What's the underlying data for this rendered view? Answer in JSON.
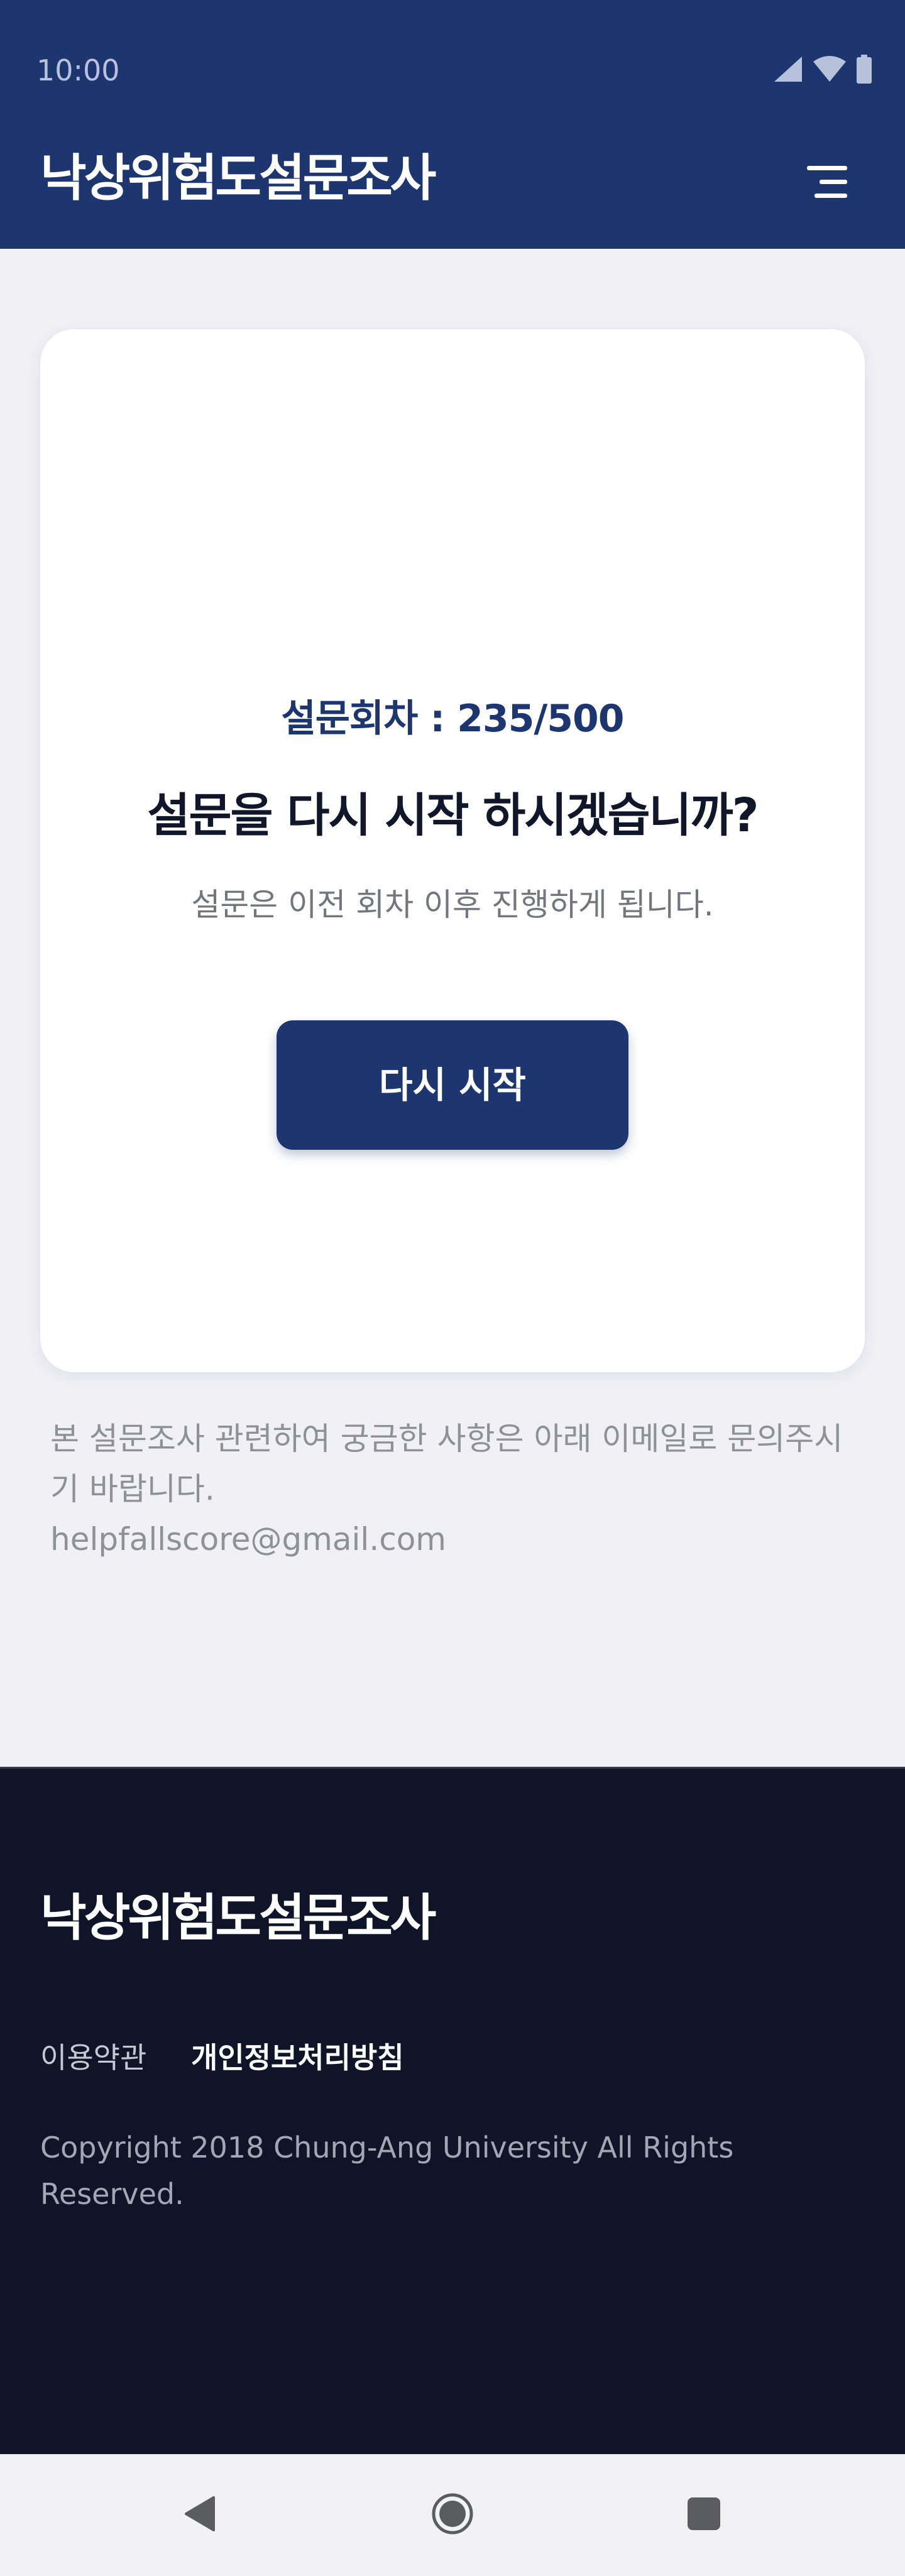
{
  "status_bar": {
    "time": "10:00",
    "icons": [
      "signal-icon",
      "wifi-icon",
      "battery-icon"
    ]
  },
  "header": {
    "title": "낙상위험도설문조사",
    "menu_icon": "menu-icon"
  },
  "card": {
    "round_label": "설문회차 :",
    "round_value": "235/500",
    "question": "설문을 다시 시작 하시겠습니까?",
    "subtext": "설문은 이전 회차 이후 진행하게 됩니다.",
    "restart_button": "다시 시작"
  },
  "help": {
    "text": "본 설문조사 관련하여 궁금한 사항은 아래 이메일로 문의주시기 바랍니다.",
    "email": "helpfallscore@gmail.com"
  },
  "footer": {
    "title": "낙상위험도설문조사",
    "links": {
      "terms": "이용약관",
      "privacy": "개인정보처리방침"
    },
    "copyright": "Copyright 2018 Chung-Ang University All Rights Reserved."
  },
  "nav_bar": {
    "icons": [
      "back-icon",
      "home-icon",
      "recents-icon"
    ]
  },
  "colors": {
    "primary": "#1e3670",
    "footer_background": "#0f1428",
    "page_background": "#f0f0f5",
    "card_background": "#ffffff"
  }
}
